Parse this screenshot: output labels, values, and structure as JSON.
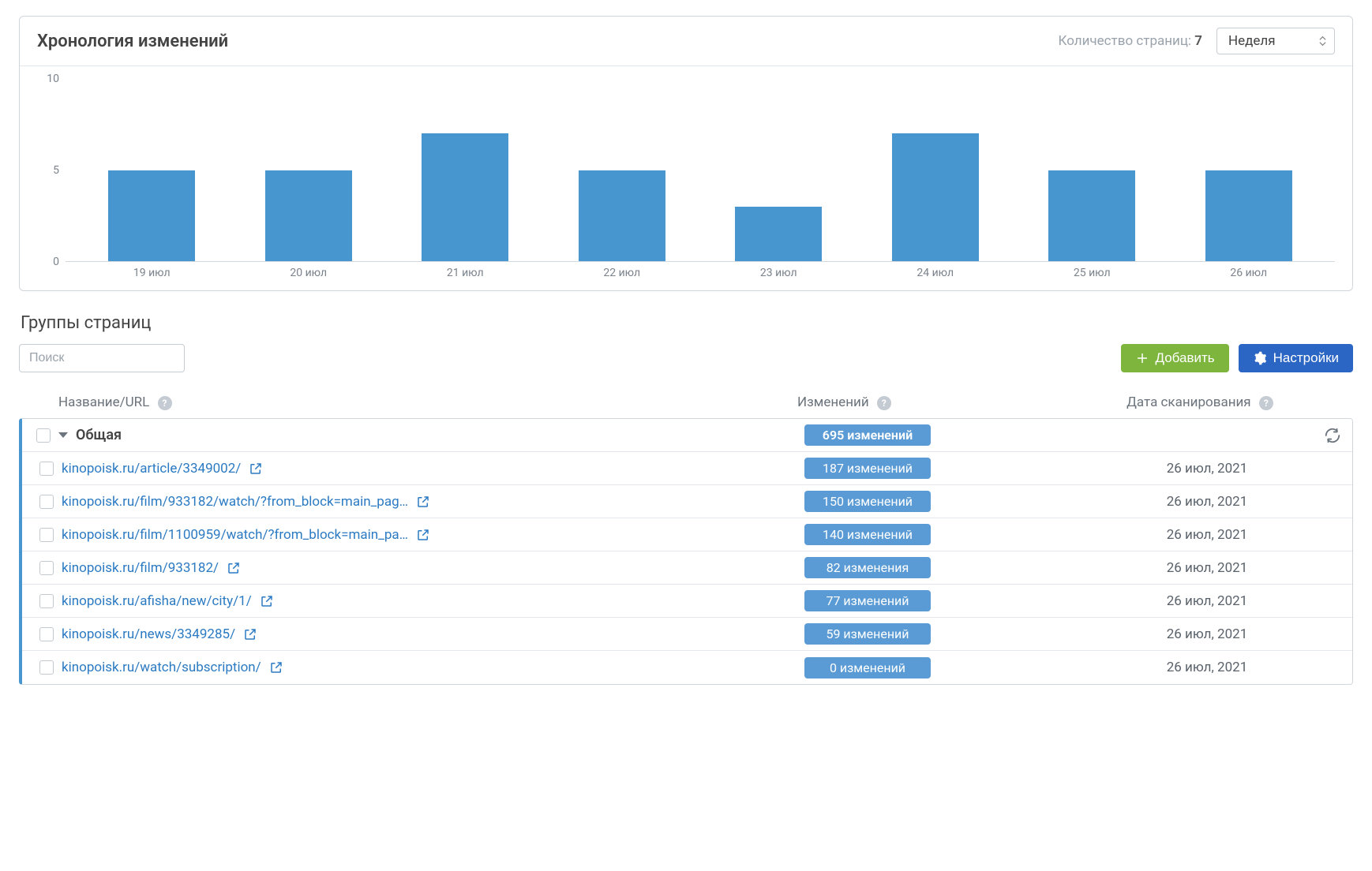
{
  "colors": {
    "bar": "#4896cf",
    "accent_blue": "#2b66c4",
    "accent_green": "#7db53d"
  },
  "chart_card": {
    "title": "Хронология изменений",
    "pages_label": "Количество страниц:",
    "pages_count": "7",
    "range_selected": "Неделя"
  },
  "chart_data": {
    "type": "bar",
    "categories": [
      "19 июл",
      "20 июл",
      "21 июл",
      "22 июл",
      "23 июл",
      "24 июл",
      "25 июл",
      "26 июл"
    ],
    "values": [
      5,
      5,
      7,
      5,
      3,
      7,
      5,
      5
    ],
    "title": "Хронология изменений",
    "xlabel": "",
    "ylabel": "",
    "ylim": [
      0,
      10
    ],
    "yticks": [
      0,
      5,
      10
    ]
  },
  "section": {
    "title": "Группы страниц"
  },
  "toolbar": {
    "search_placeholder": "Поиск",
    "add_label": "Добавить",
    "settings_label": "Настройки"
  },
  "columns": {
    "name": "Название/URL",
    "changes": "Изменений",
    "scan_date": "Дата сканирования"
  },
  "group": {
    "name": "Общая",
    "changes_badge": "695 изменений"
  },
  "rows": [
    {
      "url": "kinopoisk.ru/article/3349002/",
      "changes": "187 изменений",
      "date": "26 июл, 2021"
    },
    {
      "url": "kinopoisk.ru/film/933182/watch/?from_block=main_pag…",
      "changes": "150 изменений",
      "date": "26 июл, 2021"
    },
    {
      "url": "kinopoisk.ru/film/1100959/watch/?from_block=main_pa…",
      "changes": "140 изменений",
      "date": "26 июл, 2021"
    },
    {
      "url": "kinopoisk.ru/film/933182/",
      "changes": "82 изменения",
      "date": "26 июл, 2021"
    },
    {
      "url": "kinopoisk.ru/afisha/new/city/1/",
      "changes": "77 изменений",
      "date": "26 июл, 2021"
    },
    {
      "url": "kinopoisk.ru/news/3349285/",
      "changes": "59 изменений",
      "date": "26 июл, 2021"
    },
    {
      "url": "kinopoisk.ru/watch/subscription/",
      "changes": "0 изменений",
      "date": "26 июл, 2021"
    }
  ]
}
